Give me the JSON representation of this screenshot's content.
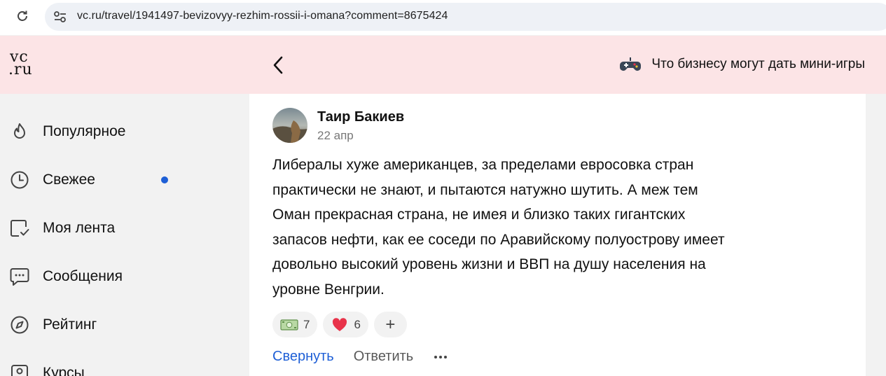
{
  "browser": {
    "url": "vc.ru/travel/1941497-bevizovyy-rezhim-rossii-i-omana?comment=8675424",
    "reload_icon": "reload-icon",
    "site_info_icon": "tune-icon"
  },
  "header": {
    "logo_line1": "vc",
    "logo_line2": ".ru",
    "back_icon": "chevron-left-icon",
    "promo_icon": "gamepad-icon",
    "promo_text": "Что бизнесу могут дать мини-игры"
  },
  "sidebar": {
    "items": [
      {
        "label": "Популярное",
        "icon": "flame-icon"
      },
      {
        "label": "Свежее",
        "icon": "clock-icon",
        "has_new_dot": true
      },
      {
        "label": "Моя лента",
        "icon": "feed-check-icon"
      },
      {
        "label": "Сообщения",
        "icon": "chat-bubble-icon"
      },
      {
        "label": "Рейтинг",
        "icon": "compass-icon"
      },
      {
        "label": "Курсы",
        "icon": "person-badge-icon"
      }
    ]
  },
  "comment": {
    "author": "Таир Бакиев",
    "date": "22 апр",
    "text_lines": [
      "Либералы хуже американцев, за пределами евросовка стран",
      "практически не знают, и пытаются натужно шутить. А меж тем",
      "Оман прекрасная страна, не имея и близко таких гигантских",
      "запасов нефти, как ее соседи по Аравийскому полуострову имеет",
      "довольно высокий уровень жизни и ВВП на душу населения на",
      "уровне Венгрии."
    ],
    "reactions": [
      {
        "icon": "money-banknote-icon",
        "count": "7"
      },
      {
        "icon": "heart-icon",
        "count": "6"
      }
    ],
    "add_reaction_label": "+",
    "collapse_label": "Свернуть",
    "reply_label": "Ответить",
    "more_icon": "more-horizontal-icon"
  },
  "colors": {
    "header_bg": "#fce4e6",
    "accent_blue": "#1e5fd6",
    "heart_red": "#e8334a",
    "sidebar_bg": "#f2f2f2"
  }
}
